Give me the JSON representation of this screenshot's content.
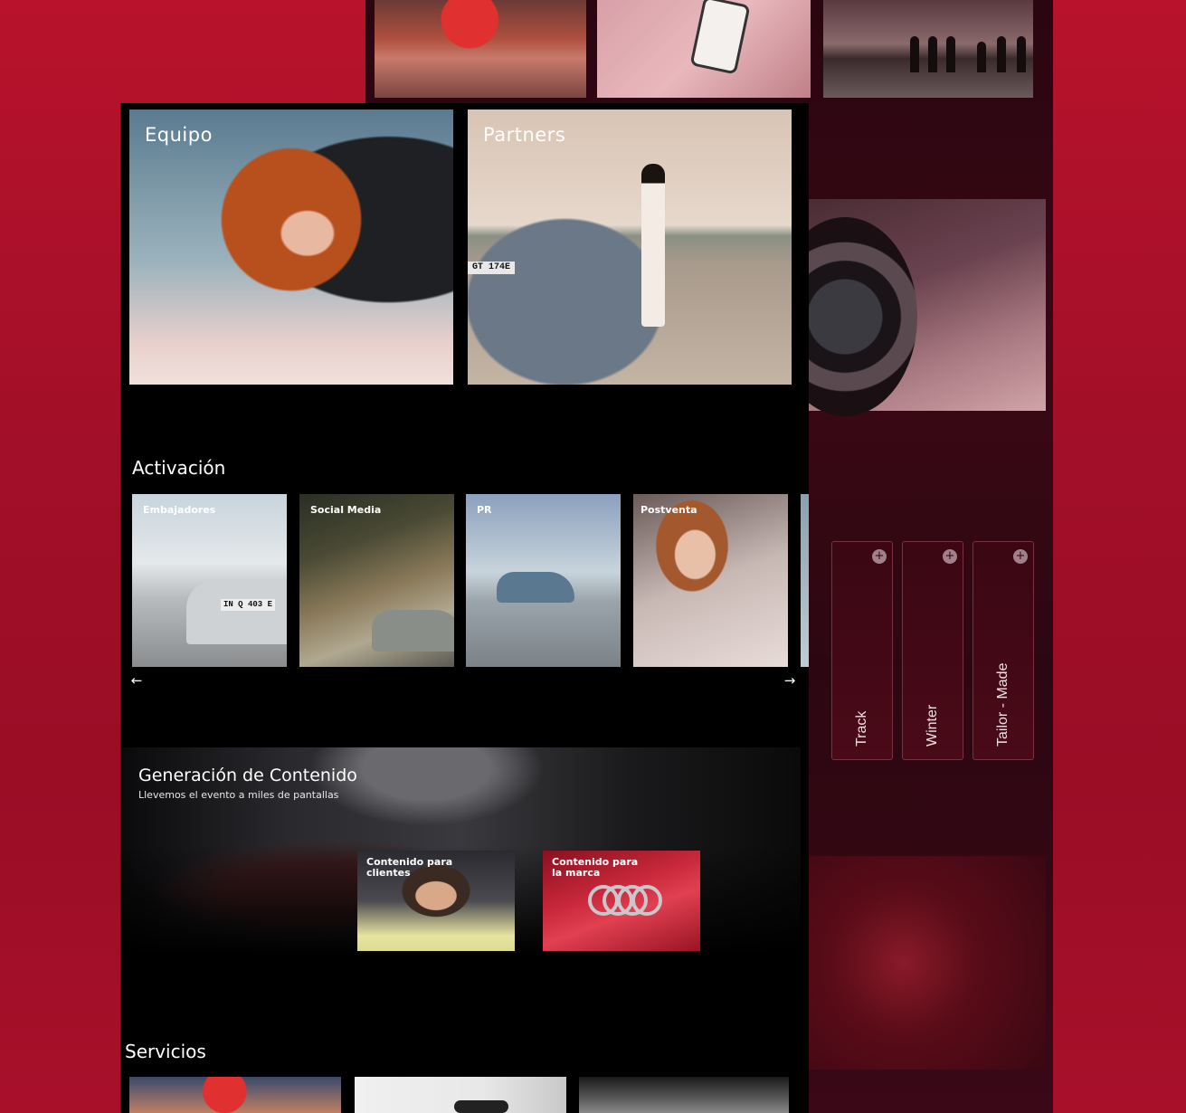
{
  "colors": {
    "page_background": "#a8102a",
    "front_panel": "#000000",
    "back_panel": "#2e0711",
    "text": "#ffffff"
  },
  "background_mockup": {
    "side_cards": [
      {
        "label": "Track"
      },
      {
        "label": "Winter"
      },
      {
        "label": "Tailor - Made"
      }
    ],
    "side_card_icon": "plus-circle-icon"
  },
  "front_mockup": {
    "hero_cards": [
      {
        "label": "Equipo"
      },
      {
        "label": "Partners"
      }
    ],
    "partners_plate": "GT 174E",
    "activacion": {
      "title": "Activación",
      "cards": [
        {
          "label": "Embajadores",
          "plate": "IN Q 403 E"
        },
        {
          "label": "Social Media"
        },
        {
          "label": "PR"
        },
        {
          "label": "Postventa"
        }
      ],
      "prev_icon": "arrow-left-icon",
      "next_icon": "arrow-right-icon"
    },
    "generacion": {
      "title": "Generación de Contenido",
      "subtitle": "Llevemos el evento a miles de pantallas",
      "cards": [
        {
          "label_line1": "Contenido para",
          "label_line2": "clientes"
        },
        {
          "label_line1": "Contenido para",
          "label_line2": "la marca"
        }
      ]
    },
    "servicios": {
      "title": "Servicios"
    }
  }
}
